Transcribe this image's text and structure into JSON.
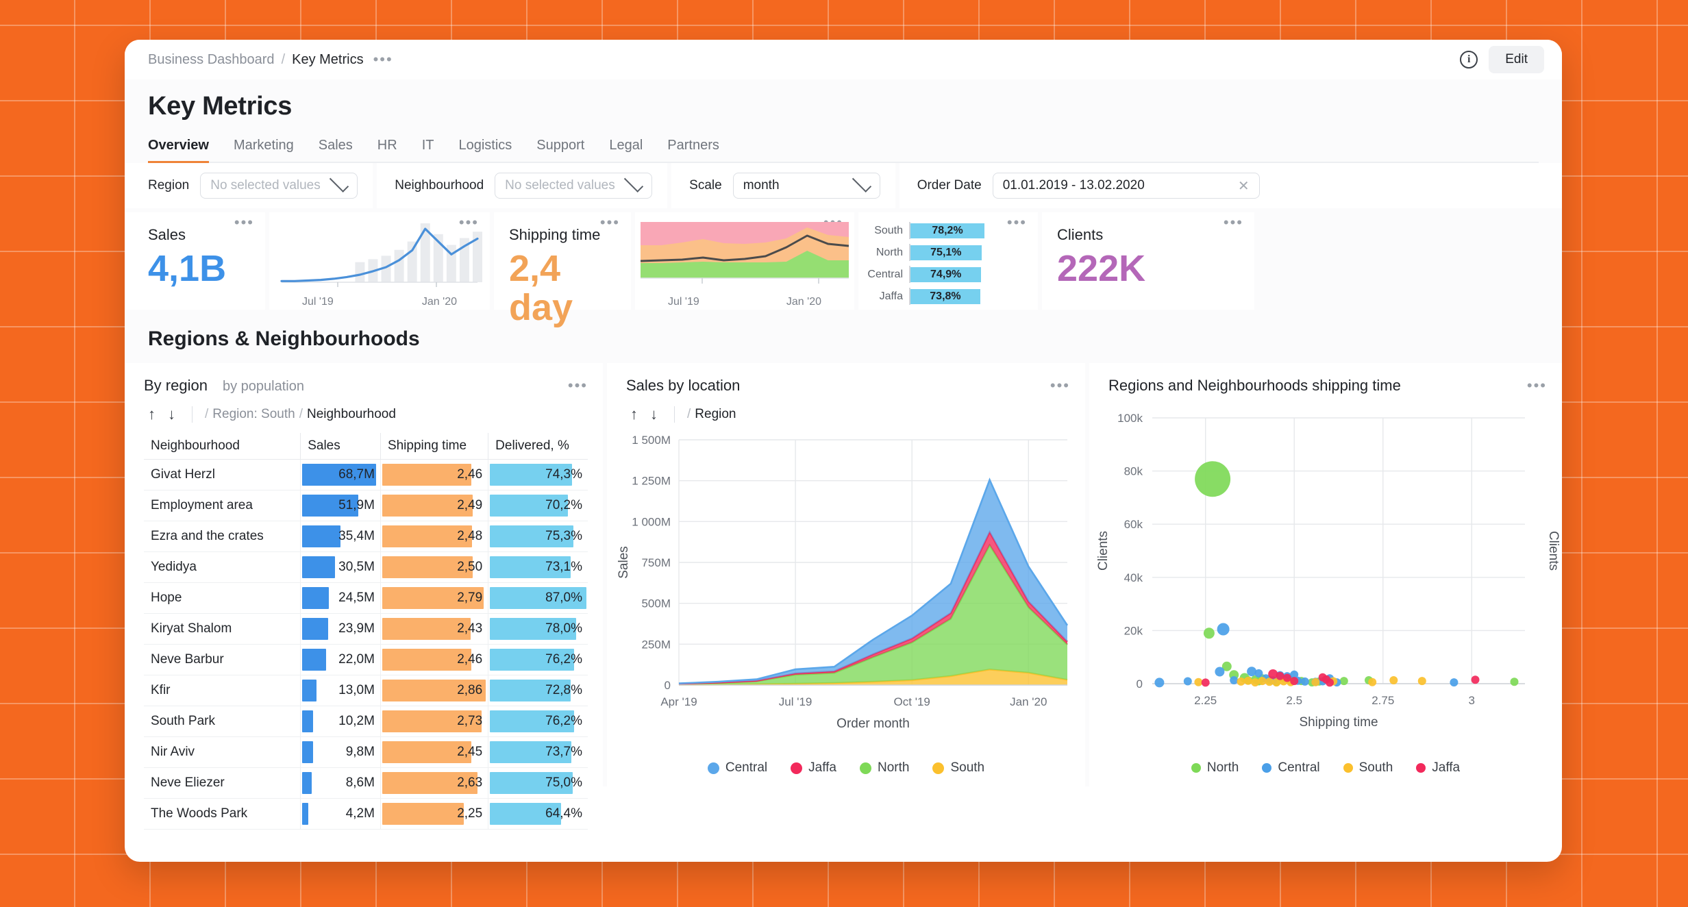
{
  "breadcrumb": {
    "root": "Business Dashboard",
    "sep": "/",
    "current": "Key Metrics",
    "more": "•••"
  },
  "topbar": {
    "info_icon": "info-icon",
    "edit_label": "Edit"
  },
  "header": {
    "title": "Key Metrics"
  },
  "tabs": [
    {
      "label": "Overview",
      "active": true
    },
    {
      "label": "Marketing",
      "active": false
    },
    {
      "label": "Sales",
      "active": false
    },
    {
      "label": "HR",
      "active": false
    },
    {
      "label": "IT",
      "active": false
    },
    {
      "label": "Logistics",
      "active": false
    },
    {
      "label": "Support",
      "active": false
    },
    {
      "label": "Legal",
      "active": false
    },
    {
      "label": "Partners",
      "active": false
    }
  ],
  "filters": {
    "region": {
      "label": "Region",
      "value": "",
      "placeholder": "No selected values"
    },
    "neighbourhood": {
      "label": "Neighbourhood",
      "value": "",
      "placeholder": "No selected values"
    },
    "scale": {
      "label": "Scale",
      "value": "month"
    },
    "order_date": {
      "label": "Order Date",
      "value": "01.01.2019 - 13.02.2020",
      "clear_icon": "close-icon"
    }
  },
  "kpis": {
    "sales": {
      "title": "Sales",
      "value": "4,1B",
      "color": "#3d91e8",
      "menu": "•••"
    },
    "shipping_time": {
      "title": "Shipping time",
      "value": "2,4 day",
      "color": "#f2a357",
      "menu": "•••"
    },
    "clients": {
      "title": "Clients",
      "value": "222K",
      "color": "#b467b8",
      "menu": "•••"
    },
    "sales_spark": {
      "menu": "•••",
      "x_left": "Jul '19",
      "x_right": "Jan '20"
    },
    "shipping_spark": {
      "menu": "•••",
      "x_left": "Jul '19",
      "x_right": "Jan '20"
    },
    "delivered_bars": {
      "menu": "•••",
      "rows": [
        {
          "label": "South",
          "value": "78,2%",
          "pct": 78.2
        },
        {
          "label": "North",
          "value": "75,1%",
          "pct": 75.1
        },
        {
          "label": "Central",
          "value": "74,9%",
          "pct": 74.9
        },
        {
          "label": "Jaffa",
          "value": "73,8%",
          "pct": 73.8
        }
      ]
    }
  },
  "section": {
    "title": "Regions & Neighbourhoods"
  },
  "by_region": {
    "title": "By region",
    "subtitle": "by population",
    "menu": "•••",
    "drill": {
      "up": "↑",
      "down": "↓",
      "sep": "/",
      "level1": "Region: South",
      "sep2": "/",
      "level2": "Neighbourhood"
    },
    "columns": [
      "Neighbourhood",
      "Sales",
      "Shipping time",
      "Delivered, %"
    ],
    "rows": [
      {
        "name": "Givat Herzl",
        "sales": "68,7M",
        "sales_n": 68.7,
        "ship": "2,46",
        "ship_n": 2.46,
        "del": "74,3%",
        "del_n": 74.3
      },
      {
        "name": "Employment area",
        "sales": "51,9M",
        "sales_n": 51.9,
        "ship": "2,49",
        "ship_n": 2.49,
        "del": "70,2%",
        "del_n": 70.2
      },
      {
        "name": "Ezra and the crates",
        "sales": "35,4M",
        "sales_n": 35.4,
        "ship": "2,48",
        "ship_n": 2.48,
        "del": "75,3%",
        "del_n": 75.3
      },
      {
        "name": "Yedidya",
        "sales": "30,5M",
        "sales_n": 30.5,
        "ship": "2,50",
        "ship_n": 2.5,
        "del": "73,1%",
        "del_n": 73.1
      },
      {
        "name": "Hope",
        "sales": "24,5M",
        "sales_n": 24.5,
        "ship": "2,79",
        "ship_n": 2.79,
        "del": "87,0%",
        "del_n": 87.0
      },
      {
        "name": "Kiryat Shalom",
        "sales": "23,9M",
        "sales_n": 23.9,
        "ship": "2,43",
        "ship_n": 2.43,
        "del": "78,0%",
        "del_n": 78.0
      },
      {
        "name": "Neve Barbur",
        "sales": "22,0M",
        "sales_n": 22.0,
        "ship": "2,46",
        "ship_n": 2.46,
        "del": "76,2%",
        "del_n": 76.2
      },
      {
        "name": "Kfir",
        "sales": "13,0M",
        "sales_n": 13.0,
        "ship": "2,86",
        "ship_n": 2.86,
        "del": "72,8%",
        "del_n": 72.8
      },
      {
        "name": "South Park",
        "sales": "10,2M",
        "sales_n": 10.2,
        "ship": "2,73",
        "ship_n": 2.73,
        "del": "76,2%",
        "del_n": 76.2
      },
      {
        "name": "Nir Aviv",
        "sales": "9,8M",
        "sales_n": 9.8,
        "ship": "2,45",
        "ship_n": 2.45,
        "del": "73,7%",
        "del_n": 73.7
      },
      {
        "name": "Neve Eliezer",
        "sales": "8,6M",
        "sales_n": 8.6,
        "ship": "2,63",
        "ship_n": 2.63,
        "del": "75,0%",
        "del_n": 75.0
      },
      {
        "name": "The Woods Park",
        "sales": "4,2M",
        "sales_n": 4.2,
        "ship": "2,25",
        "ship_n": 2.25,
        "del": "64,4%",
        "del_n": 64.4
      }
    ]
  },
  "sales_by_location": {
    "title": "Sales by location",
    "menu": "•••",
    "drill": {
      "up": "↑",
      "down": "↓",
      "sep": "/",
      "level": "Region"
    }
  },
  "shipping_scatter": {
    "title": "Regions and Neighbourhoods shipping time",
    "menu": "•••"
  },
  "chart_data": [
    {
      "type": "area",
      "name": "sales-by-location",
      "title": "Sales by location",
      "xlabel": "Order month",
      "ylabel": "Sales",
      "ylim": [
        0,
        1500
      ],
      "yticks": [
        0,
        250,
        500,
        750,
        1000,
        1250,
        1500
      ],
      "ytick_labels": [
        "0",
        "250M",
        "500M",
        "750M",
        "1 000M",
        "1 250M",
        "1 500M"
      ],
      "x": [
        "Apr '19",
        "May '19",
        "Jun '19",
        "Jul '19",
        "Aug '19",
        "Sep '19",
        "Oct '19",
        "Nov '19",
        "Dec '19",
        "Jan '20",
        "Feb '20"
      ],
      "xtick_labels": [
        "Apr '19",
        "Jul '19",
        "Oct '19",
        "Jan '20"
      ],
      "stacked": true,
      "grid": true,
      "legend_position": "bottom",
      "series": [
        {
          "name": "South",
          "color": "#fbc02d",
          "values": [
            2,
            3,
            5,
            8,
            12,
            20,
            30,
            55,
            95,
            75,
            32
          ]
        },
        {
          "name": "North",
          "color": "#7ed957",
          "values": [
            5,
            10,
            18,
            55,
            62,
            150,
            230,
            350,
            760,
            400,
            215
          ]
        },
        {
          "name": "Jaffa",
          "color": "#f2295b",
          "values": [
            1,
            2,
            3,
            8,
            10,
            18,
            25,
            35,
            80,
            35,
            18
          ]
        },
        {
          "name": "Central",
          "color": "#5ba7ea",
          "values": [
            2,
            5,
            9,
            25,
            28,
            90,
            140,
            180,
            320,
            215,
            100
          ]
        }
      ],
      "legend": [
        "Central",
        "Jaffa",
        "North",
        "South"
      ]
    },
    {
      "type": "scatter",
      "name": "regions-shipping-time",
      "title": "Regions and Neighbourhoods shipping time",
      "xlabel": "Shipping time",
      "ylabel": "Clients",
      "ylabel_right": "Clients",
      "xlim": [
        2.1,
        3.15
      ],
      "ylim": [
        0,
        100
      ],
      "yticks": [
        0,
        20,
        40,
        60,
        80,
        100
      ],
      "ytick_labels": [
        "0",
        "20k",
        "40k",
        "60k",
        "80k",
        "100k"
      ],
      "xticks": [
        2.25,
        2.5,
        2.75,
        3
      ],
      "xtick_labels": [
        "2.25",
        "2.5",
        "2.75",
        "3"
      ],
      "grid": true,
      "legend_position": "bottom",
      "legend": [
        "North",
        "Central",
        "South",
        "Jaffa"
      ],
      "series": [
        {
          "name": "North",
          "color": "#7ed957",
          "points": [
            [
              2.27,
              77,
              26
            ],
            [
              2.26,
              19,
              8
            ],
            [
              2.31,
              6.5,
              7
            ],
            [
              2.33,
              3.3,
              7
            ],
            [
              2.36,
              2.2,
              7
            ],
            [
              2.37,
              1.3,
              6
            ],
            [
              2.39,
              1.6,
              6
            ],
            [
              2.4,
              0.9,
              6
            ],
            [
              2.41,
              2.0,
              6
            ],
            [
              2.43,
              1.4,
              6
            ],
            [
              2.45,
              0.6,
              6
            ],
            [
              2.47,
              2.0,
              6
            ],
            [
              2.49,
              1.3,
              6
            ],
            [
              2.52,
              1.0,
              6
            ],
            [
              2.55,
              0.5,
              6
            ],
            [
              2.57,
              0.8,
              6
            ],
            [
              2.64,
              1.0,
              6
            ],
            [
              2.71,
              1.3,
              6
            ],
            [
              3.12,
              0.7,
              6
            ]
          ]
        },
        {
          "name": "Central",
          "color": "#4a9fe8",
          "points": [
            [
              2.12,
              0.4,
              7
            ],
            [
              2.2,
              0.9,
              6
            ],
            [
              2.29,
              4.5,
              7
            ],
            [
              2.3,
              20.5,
              9
            ],
            [
              2.33,
              1.3,
              6
            ],
            [
              2.38,
              4.6,
              7
            ],
            [
              2.4,
              3.9,
              6
            ],
            [
              2.42,
              2.0,
              6
            ],
            [
              2.44,
              1.2,
              6
            ],
            [
              2.46,
              3.2,
              6
            ],
            [
              2.48,
              2.8,
              6
            ],
            [
              2.5,
              3.4,
              6
            ],
            [
              2.51,
              1.1,
              6
            ],
            [
              2.53,
              0.8,
              6
            ],
            [
              2.56,
              0.7,
              6
            ],
            [
              2.58,
              0.9,
              6
            ],
            [
              2.6,
              2.0,
              6
            ],
            [
              2.62,
              0.5,
              6
            ],
            [
              2.95,
              0.5,
              6
            ]
          ]
        },
        {
          "name": "South",
          "color": "#fbc02d",
          "points": [
            [
              2.23,
              0.6,
              6
            ],
            [
              2.35,
              0.8,
              6
            ],
            [
              2.37,
              1.1,
              6
            ],
            [
              2.39,
              0.5,
              6
            ],
            [
              2.41,
              1.0,
              6
            ],
            [
              2.43,
              0.7,
              6
            ],
            [
              2.45,
              0.5,
              6
            ],
            [
              2.47,
              0.9,
              6
            ],
            [
              2.49,
              0.6,
              6
            ],
            [
              2.56,
              0.6,
              6
            ],
            [
              2.61,
              0.9,
              6
            ],
            [
              2.72,
              0.6,
              6
            ],
            [
              2.78,
              1.3,
              6
            ],
            [
              2.86,
              1.0,
              6
            ]
          ]
        },
        {
          "name": "Jaffa",
          "color": "#f2295b",
          "points": [
            [
              2.25,
              0.4,
              6
            ],
            [
              2.44,
              3.6,
              7
            ],
            [
              2.46,
              2.9,
              6
            ],
            [
              2.48,
              2.2,
              6
            ],
            [
              2.5,
              1.0,
              6
            ],
            [
              2.58,
              2.4,
              6
            ],
            [
              2.59,
              1.6,
              6
            ],
            [
              2.6,
              0.4,
              6
            ],
            [
              3.01,
              1.5,
              6
            ]
          ]
        }
      ]
    },
    {
      "type": "line",
      "name": "sales-sparkline",
      "title": "",
      "color": "#4a90d9",
      "values": [
        2,
        2,
        3,
        4,
        6,
        9,
        13,
        19,
        26,
        38,
        55,
        92,
        70,
        48,
        62,
        75
      ],
      "xtick_labels": [
        "Jul '19",
        "Jan '20"
      ]
    },
    {
      "type": "area",
      "name": "shipping-time-sparkline",
      "title": "",
      "xtick_labels": [
        "Jul '19",
        "Jan '20"
      ],
      "series": [
        {
          "name": "band-green",
          "color": "#95de72"
        },
        {
          "name": "band-orange",
          "color": "#fbc089"
        },
        {
          "name": "band-pink",
          "color": "#f9a7b6"
        },
        {
          "name": "trend-line",
          "color": "#4b4b4b"
        }
      ]
    },
    {
      "type": "bar",
      "name": "delivered-by-region",
      "orientation": "horizontal",
      "color": "#76d0ef",
      "categories": [
        "South",
        "North",
        "Central",
        "Jaffa"
      ],
      "values": [
        78.2,
        75.1,
        74.9,
        73.8
      ],
      "value_labels": [
        "78,2%",
        "75,1%",
        "74,9%",
        "73,8%"
      ]
    }
  ]
}
